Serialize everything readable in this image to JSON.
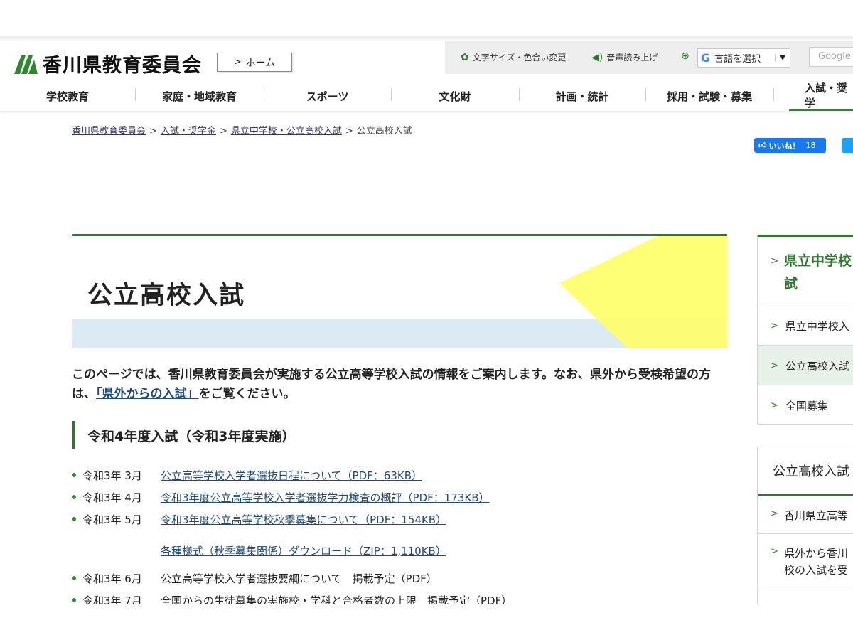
{
  "header": {
    "site_name": "香川県教育委員会",
    "home_label": "ホーム",
    "util": {
      "text_size": "文字サイズ・色合い変更",
      "speech": "音声読み上げ",
      "language": "言語を選択",
      "search_placeholder": "Google"
    }
  },
  "gnav": [
    {
      "label": "学校教育"
    },
    {
      "label": "家庭・地域教育"
    },
    {
      "label": "スポーツ"
    },
    {
      "label": "文化財"
    },
    {
      "label": "計画・統計"
    },
    {
      "label": "採用・試験・募集"
    },
    {
      "label": "入試・奨学"
    }
  ],
  "breadcrumb": {
    "items": [
      "香川県教育委員会",
      "入試・奨学金",
      "県立中学校・公立高校入試"
    ],
    "current": "公立高校入試",
    "separator": ">"
  },
  "social": {
    "like_label": "いいね！",
    "like_count": "18"
  },
  "page": {
    "title": "公立高校入試",
    "intro_part1": "このページでは、香川県教育委員会が実施する公立高等学校入試の情報をご案内します。なお、県外から受検希望の方は、",
    "intro_link": "「県外からの入試」",
    "intro_part2": "をご覧ください。",
    "section_heading": "令和4年度入試（令和3年度実施）",
    "items": [
      {
        "date": "令和3年  3月",
        "text": "公立高等学校入学者選抜日程について（PDF：63KB）",
        "link": true
      },
      {
        "date": "令和3年  4月",
        "text": "令和3年度公立高等学校入学者選抜学力検査の概評（PDF：173KB）",
        "link": true
      },
      {
        "date": "令和3年  5月",
        "text": "令和3年度公立高等学校秋季募集について（PDF：154KB）",
        "link": true
      },
      {
        "date": "",
        "text": "各種様式（秋季募集関係）ダウンロード（ZIP：1,110KB）",
        "link": true
      },
      {
        "date": "令和3年  6月",
        "text": "公立高等学校入学者選抜要綱について　掲載予定（PDF）",
        "link": false
      },
      {
        "date": "令和3年  7月",
        "text": "全国からの生徒募集の実施校・学科と合格者数の上限　掲載予定（PDF）",
        "link": false
      }
    ]
  },
  "sidebar": {
    "box1_heading_line1": "県立中学校",
    "box1_heading_line2": "試",
    "box1_items": [
      "県立中学校入",
      "公立高校入試",
      "全国募集"
    ],
    "box2_heading": "公立高校入試",
    "box2_items": [
      {
        "line1": "香川県立高等",
        "line2": ""
      },
      {
        "line1": "県外から香川",
        "line2": "校の入試を受"
      }
    ]
  },
  "colors": {
    "accent_green": "#2f7a2f",
    "link": "#1f4a7a",
    "title_band": "#dcebf3",
    "deco_yellow": "#ffff66"
  }
}
